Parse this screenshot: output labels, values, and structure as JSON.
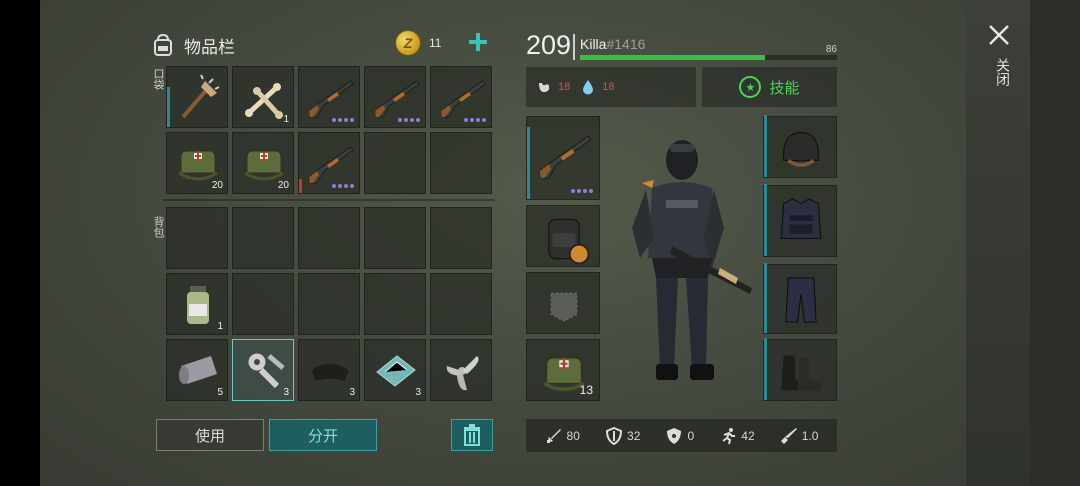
{
  "inventory": {
    "title": "物品栏",
    "coins": "11",
    "pocket_label": "口袋",
    "backpack_label": "背包",
    "pocket_slots": [
      {
        "icon": "spiked-club-icon",
        "qty": "",
        "bar": "#2c8a93"
      },
      {
        "icon": "bones-icon",
        "qty": "1"
      },
      {
        "icon": "shotgun-icon",
        "qty": "",
        "dots": 4
      },
      {
        "icon": "shotgun-icon",
        "qty": "",
        "dots": 4
      },
      {
        "icon": "shotgun-icon",
        "qty": "",
        "dots": 4
      },
      {
        "icon": "medkit-bag-icon",
        "qty": "20"
      },
      {
        "icon": "medkit-bag-icon",
        "qty": "20"
      },
      {
        "icon": "shotgun-icon",
        "qty": "",
        "dots": 4,
        "bar": "#c0392b"
      },
      {
        "icon": "",
        "qty": ""
      },
      {
        "icon": "",
        "qty": ""
      }
    ],
    "backpack_slots": [
      {
        "icon": "",
        "qty": ""
      },
      {
        "icon": "",
        "qty": ""
      },
      {
        "icon": "",
        "qty": ""
      },
      {
        "icon": "",
        "qty": ""
      },
      {
        "icon": "",
        "qty": ""
      },
      {
        "icon": "medicine-bottle-icon",
        "qty": "1"
      },
      {
        "icon": "",
        "qty": ""
      },
      {
        "icon": "",
        "qty": ""
      },
      {
        "icon": "",
        "qty": ""
      },
      {
        "icon": "",
        "qty": ""
      },
      {
        "icon": "fabric-roll-icon",
        "qty": "5"
      },
      {
        "icon": "engine-parts-icon",
        "qty": "3",
        "selected": true
      },
      {
        "icon": "black-cloth-icon",
        "qty": "3"
      },
      {
        "icon": "glass-sheet-icon",
        "qty": "3"
      },
      {
        "icon": "propeller-icon",
        "qty": ""
      }
    ],
    "use_label": "使用",
    "split_label": "分开"
  },
  "character": {
    "level": "209",
    "name": "Killa",
    "tag": "#1416",
    "xp_value": "86",
    "xp_fraction": 0.72,
    "food": "18",
    "water": "18",
    "skills_label": "技能",
    "equip_left": [
      {
        "icon": "shotgun-icon",
        "dots": 4
      },
      {
        "icon": "backpack-icon"
      },
      {
        "icon": "pocket-icon"
      },
      {
        "icon": "medkit-bag-icon",
        "qty": "13"
      }
    ],
    "equip_right": [
      {
        "icon": "helmet-icon"
      },
      {
        "icon": "police-vest-icon"
      },
      {
        "icon": "pants-icon"
      },
      {
        "icon": "boots-icon"
      }
    ],
    "stats": {
      "attack": "80",
      "defense": "32",
      "radiation": "0",
      "speed": "42",
      "stealth": "1.0"
    }
  },
  "close_label": "关闭",
  "colors": {
    "accent_teal": "#3aa3a1",
    "green": "#36c241",
    "red": "#e74a3b"
  }
}
